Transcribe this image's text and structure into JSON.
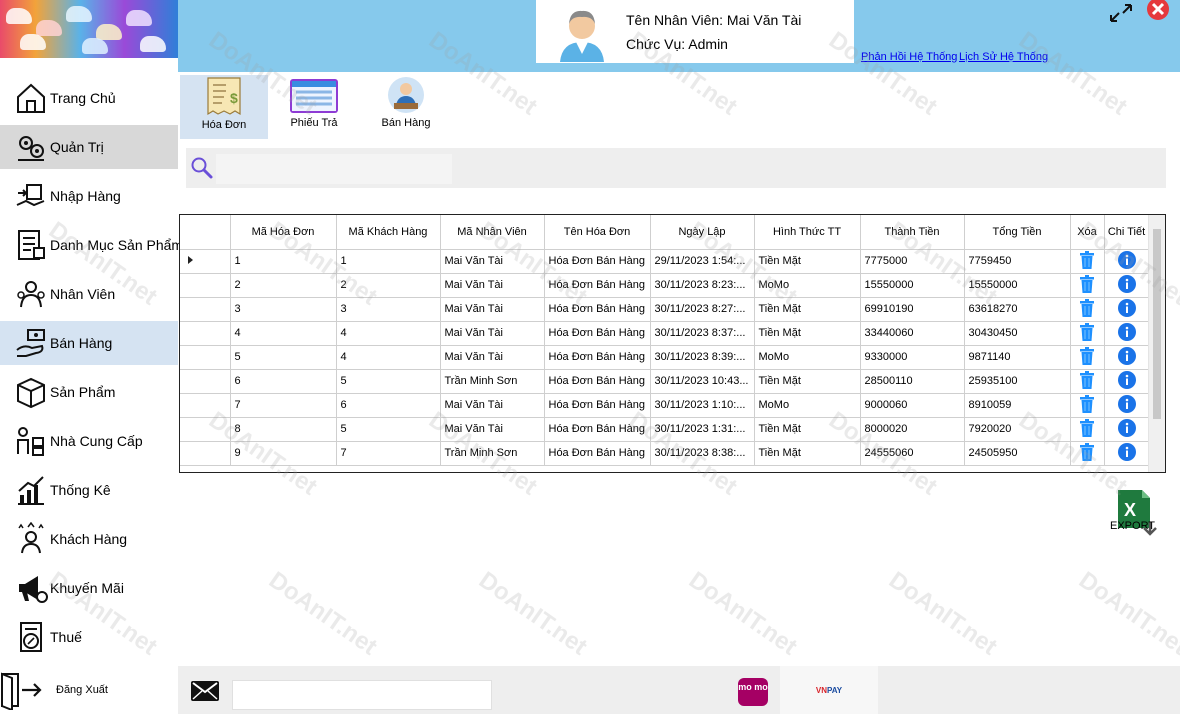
{
  "header": {
    "user_name_line": "Tên Nhân Viên: Mai Văn Tài",
    "role_line": "Chức Vụ: Admin",
    "link_feedback": "Phản Hồi Hệ Thống",
    "link_history": "Lịch Sử Hệ Thống"
  },
  "sidebar": {
    "items": [
      {
        "label": "Trang Chủ",
        "icon": "home-icon"
      },
      {
        "label": "Quản Trị",
        "icon": "gears-icon"
      },
      {
        "label": "Nhập Hàng",
        "icon": "import-icon"
      },
      {
        "label": "Danh Mục Sản Phẩm",
        "icon": "catalog-icon"
      },
      {
        "label": "Nhân Viên",
        "icon": "staff-icon"
      },
      {
        "label": "Bán Hàng",
        "icon": "sales-icon"
      },
      {
        "label": "Sản Phẩm",
        "icon": "box-icon"
      },
      {
        "label": "Nhà Cung Cấp",
        "icon": "supplier-icon"
      },
      {
        "label": "Thống Kê",
        "icon": "chart-icon"
      },
      {
        "label": "Khách Hàng",
        "icon": "customer-icon"
      },
      {
        "label": "Khuyến Mãi",
        "icon": "megaphone-icon"
      },
      {
        "label": "Thuế",
        "icon": "tax-icon"
      }
    ],
    "logout_label": "Đăng Xuất"
  },
  "toolbar": {
    "invoice_label": "Hóa Đơn",
    "return_label": "Phiếu Trả",
    "sales_label": "Bán Hàng"
  },
  "search": {
    "placeholder": ""
  },
  "table": {
    "columns": [
      "",
      "Mã Hóa Đơn",
      "Mã Khách Hàng",
      "Mã Nhân Viên",
      "Tên Hóa Đơn",
      "Ngày Lập",
      "Hình Thức TT",
      "Thành Tiền",
      "Tổng Tiền",
      "Xóa",
      "Chi Tiết"
    ],
    "rows": [
      [
        "1",
        "1",
        "Mai Văn Tài",
        "Hóa Đơn Bán Hàng",
        "29/11/2023 1:54:...",
        "Tiền Mặt",
        "7775000",
        "7759450"
      ],
      [
        "2",
        "2",
        "Mai Văn Tài",
        "Hóa Đơn Bán Hàng",
        "30/11/2023 8:23:...",
        "MoMo",
        "15550000",
        "15550000"
      ],
      [
        "3",
        "3",
        "Mai Văn Tài",
        "Hóa Đơn Bán Hàng",
        "30/11/2023 8:27:...",
        "Tiền Mặt",
        "69910190",
        "63618270"
      ],
      [
        "4",
        "4",
        "Mai Văn Tài",
        "Hóa Đơn Bán Hàng",
        "30/11/2023 8:37:...",
        "Tiền Mặt",
        "33440060",
        "30430450"
      ],
      [
        "5",
        "4",
        "Mai Văn Tài",
        "Hóa Đơn Bán Hàng",
        "30/11/2023 8:39:...",
        "MoMo",
        "9330000",
        "9871140"
      ],
      [
        "6",
        "5",
        "Trần Minh Sơn",
        "Hóa Đơn Bán Hàng",
        "30/11/2023 10:43...",
        "Tiền Mặt",
        "28500110",
        "25935100"
      ],
      [
        "7",
        "6",
        "Mai Văn Tài",
        "Hóa Đơn Bán Hàng",
        "30/11/2023 1:10:...",
        "MoMo",
        "9000060",
        "8910059"
      ],
      [
        "8",
        "5",
        "Mai Văn Tài",
        "Hóa Đơn Bán Hàng",
        "30/11/2023 1:31:...",
        "Tiền Mặt",
        "8000020",
        "7920020"
      ],
      [
        "9",
        "7",
        "Trần Minh Sơn",
        "Hóa Đơn Bán Hàng",
        "30/11/2023 8:38:...",
        "Tiền Mặt",
        "24555060",
        "24505950"
      ]
    ]
  },
  "export_label": "EXPORT",
  "footer": {
    "momo_label": "mo mo",
    "vnpay_brand": "VN",
    "vnpay_suffix": "PAY"
  },
  "watermark_text": "DoAnIT.net",
  "colors": {
    "header_bg": "#86c9ec",
    "selected_bg": "#d5e3f2",
    "trash": "#1e90ff",
    "info": "#1a73e8"
  }
}
